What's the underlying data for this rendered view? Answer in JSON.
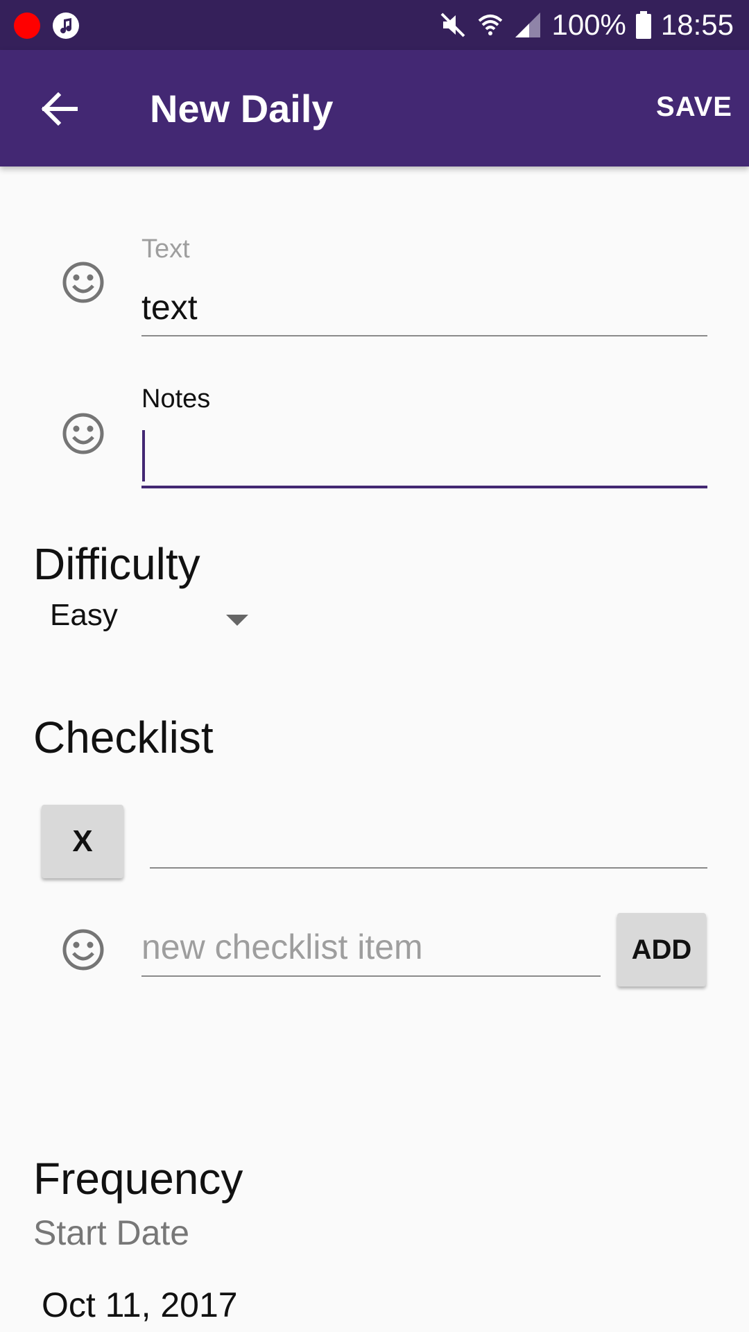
{
  "status_bar": {
    "battery": "100%",
    "time": "18:55",
    "icons": [
      "record-dot-icon",
      "music-note-icon",
      "mute-icon",
      "wifi-icon",
      "signal-icon",
      "battery-icon"
    ]
  },
  "app_bar": {
    "title": "New Daily",
    "save_label": "SAVE",
    "background": "#432873"
  },
  "form": {
    "text_label": "Text",
    "text_value": "text",
    "notes_label": "Notes",
    "notes_value": ""
  },
  "difficulty": {
    "heading": "Difficulty",
    "selected": "Easy"
  },
  "checklist": {
    "heading": "Checklist",
    "remove_label": "X",
    "new_item_placeholder": "new checklist item",
    "add_label": "ADD"
  },
  "frequency": {
    "heading": "Frequency",
    "start_date_label": "Start Date",
    "start_date_value": "Oct 11, 2017"
  },
  "colors": {
    "status_bar": "#35205a",
    "accent": "#432873",
    "background": "#fafafa"
  }
}
